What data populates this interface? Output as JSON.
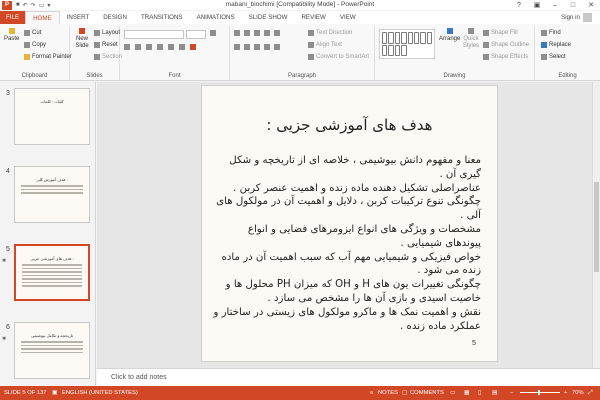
{
  "window": {
    "title": "mabani_biochimi [Compatibility Mode] - PowerPoint",
    "app_icon": "P",
    "controls": [
      "?",
      "▣",
      "–",
      "□",
      "✕"
    ]
  },
  "tabs": [
    {
      "label": "FILE"
    },
    {
      "label": "HOME"
    },
    {
      "label": "INSERT"
    },
    {
      "label": "DESIGN"
    },
    {
      "label": "TRANSITIONS"
    },
    {
      "label": "ANIMATIONS"
    },
    {
      "label": "SLIDE SHOW"
    },
    {
      "label": "REVIEW"
    },
    {
      "label": "VIEW"
    }
  ],
  "active_tab": "HOME",
  "signin": "Sign in",
  "ribbon": {
    "clipboard": {
      "label": "Clipboard",
      "paste": "Paste",
      "cut": "Cut",
      "copy": "Copy",
      "format_painter": "Format Painter"
    },
    "slides": {
      "label": "Slides",
      "new_slide": "New Slide",
      "layout": "Layout",
      "reset": "Reset",
      "section": "Section"
    },
    "font": {
      "label": "Font"
    },
    "paragraph": {
      "label": "Paragraph",
      "text_direction": "Text Direction",
      "align_text": "Align Text",
      "convert_smartart": "Convert to SmartArt"
    },
    "drawing": {
      "label": "Drawing",
      "arrange": "Arrange",
      "quick_styles": "Quick Styles",
      "shape_fill": "Shape Fill",
      "shape_outline": "Shape Outline",
      "shape_effects": "Shape Effects"
    },
    "editing": {
      "label": "Editing",
      "find": "Find",
      "replace": "Replace",
      "select": "Select"
    }
  },
  "thumbnails": [
    {
      "number": "3",
      "title": "کلیات : کلمات"
    },
    {
      "number": "4",
      "title": "هدف آموزش کلی :"
    },
    {
      "number": "5",
      "title": "هدف های آموزشی جزیی :"
    },
    {
      "number": "6",
      "title": "تاریخچه و تکامل بیوشیمی"
    }
  ],
  "slide": {
    "title": "هدف های آموزشی جزیی :",
    "body": [
      "معنا و مفهوم دانش بیوشیمی ، خلاصه ای از تاریخچه و شکل گیری آن .",
      "عناصراصلی تشکیل دهنده ماده زنده و اهمیت عنصر کربن .",
      "چگونگی تنوع ترکیبات کربن ، دلایل و اهمیت آن در مولکول های آلی .",
      "مشخصات و ویژگی های انواع ایزومرهای فضایی و انواع پیوندهای شیمیایی .",
      "خواص فیزیکی و شیمیایی مهم آب که سبب اهمیت آن در ماده زنده می شود .",
      "چگونگی تغییرات یون های H و OH که میزان PH محلول ها و خاصیت اسیدی و بازی آن ها را مشخص می سازد .",
      "نقش و اهمیت نمک ها و ماکرو مولکول های زیستی در ساختار و عملکرد ماده زنده ."
    ],
    "number": "5"
  },
  "notes_placeholder": "Click to add notes",
  "status": {
    "slide_info": "SLIDE 5 OF 137",
    "language": "ENGLISH (UNITED STATES)",
    "notes": "NOTES",
    "comments": "COMMENTS",
    "zoom": "70%",
    "zoom_fraction": 0.45
  },
  "colors": {
    "accent": "#d24726"
  }
}
